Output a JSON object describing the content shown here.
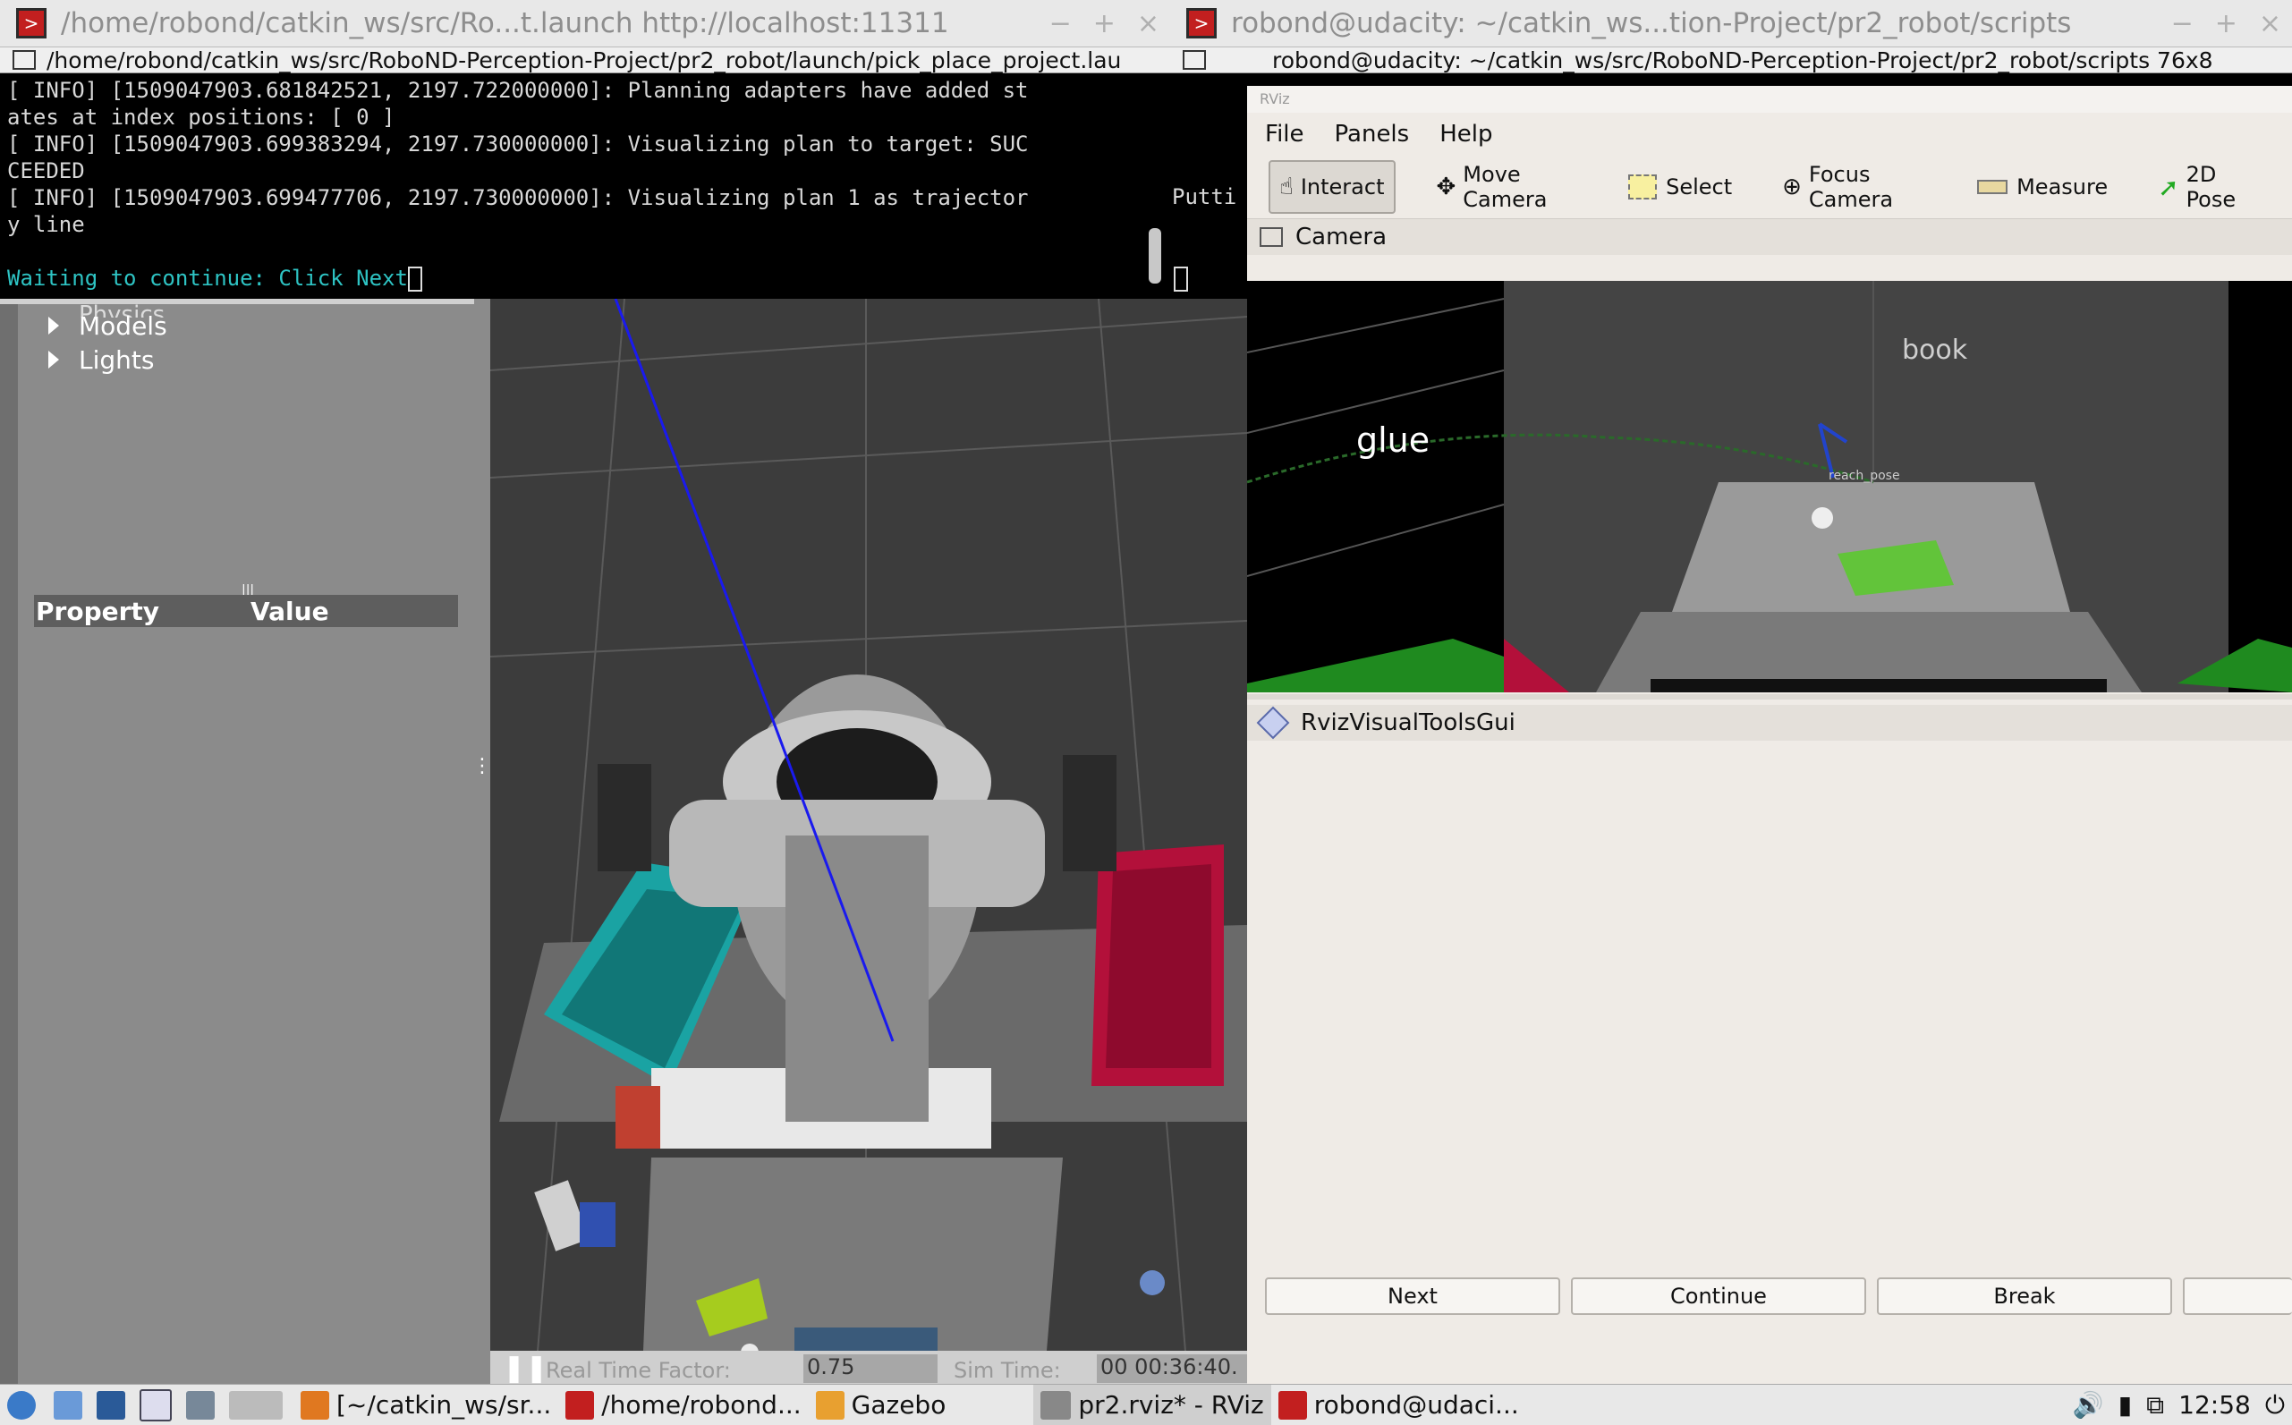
{
  "terminal1": {
    "title": "/home/robond/catkin_ws/src/Ro...t.launch http://localhost:11311",
    "path": "/home/robond/catkin_ws/src/RoboND-Perception-Project/pr2_robot/launch/pick_place_project.lau",
    "lines": [
      "[ INFO] [1509047903.681842521, 2197.722000000]: Planning adapters have added st",
      "ates at index positions: [ 0 ]",
      "[ INFO] [1509047903.699383294, 2197.730000000]: Visualizing plan to target: SUC",
      "CEEDED",
      "[ INFO] [1509047903.699477706, 2197.730000000]: Visualizing plan 1 as trajector",
      "y line",
      ""
    ],
    "prompt": "Waiting to continue: Click Next"
  },
  "terminal2": {
    "title": "robond@udacity: ~/catkin_ws...tion-Project/pr2_robot/scripts",
    "path": "robond@udacity: ~/catkin_ws/src/RoboND-Perception-Project/pr2_robot/scripts 76x8",
    "partial_text": "Putti"
  },
  "gazebo": {
    "tree_partial": "Physics",
    "tree_items": [
      "Models",
      "Lights"
    ],
    "property_header": "Property",
    "value_header": "Value",
    "rtf_label": "Real Time Factor:",
    "rtf_value": "0.75",
    "sim_time_label": "Sim Time:",
    "sim_time_value": "00 00:36:40."
  },
  "rviz": {
    "title": "RViz",
    "menu": [
      "File",
      "Panels",
      "Help"
    ],
    "tools": [
      "Interact",
      "Move Camera",
      "Select",
      "Focus Camera",
      "Measure",
      "2D Pose"
    ],
    "camera_panel": "Camera",
    "camera_labels": {
      "book": "book",
      "glue": "glue",
      "reach": "reach_pose"
    },
    "tools_panel": "RvizVisualToolsGui",
    "buttons": [
      "Next",
      "Continue",
      "Break"
    ]
  },
  "taskbar": {
    "items": [
      "[~/catkin_ws/sr...",
      "/home/robond...",
      "Gazebo",
      "pr2.rviz* - RViz",
      "robond@udaci..."
    ],
    "clock": "12:58"
  },
  "colors": {
    "terminal_bg": "#000000",
    "terminal_text": "#d8d8d8",
    "prompt_cyan": "#2ec4c4",
    "gazebo_panel": "#8b8b8b",
    "rviz_bg": "#efebe6",
    "bin_teal": "#1aa3a3",
    "bin_red": "#b3103a",
    "grid_green": "#2ecc40"
  }
}
